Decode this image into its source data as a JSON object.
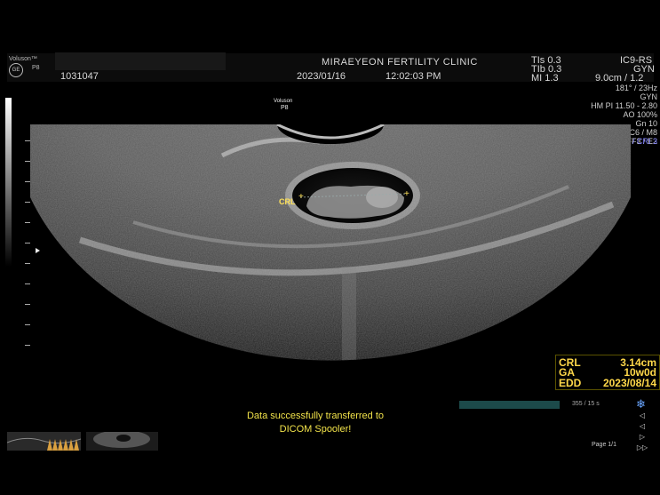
{
  "header": {
    "brand": "Voluson™",
    "probe_small": "P8",
    "patient_id": "1031047",
    "clinic": "MIRAEYEON FERTILITY CLINIC",
    "date": "2023/01/16",
    "time": "12:02:03 PM",
    "tis": "TIs  0.3",
    "tib": "TIb  0.3",
    "mi": "MI   1.3",
    "probe_mode": "IC9-RS",
    "app": "GYN",
    "depth": "9.0cm / 1.2"
  },
  "right_params": [
    "181° / 23Hz",
    "GYN",
    "HM PI 11.50 - 2.80",
    "AO 100%",
    "Gn 10",
    "C6 / M8",
    "FF3 / E2",
    "SRI II 3 / CRI 3"
  ],
  "probe_overlay": {
    "brand": "Voluson",
    "probe": "P8"
  },
  "measurement": {
    "crl_marker": "CRL"
  },
  "results": [
    {
      "label": "CRL",
      "value": "3.14cm"
    },
    {
      "label": "GA",
      "value": "10w0d"
    },
    {
      "label": "EDD",
      "value": "2023/08/14"
    }
  ],
  "status": {
    "line1": "Data successfully transferred to",
    "line2": "DICOM Spooler!"
  },
  "cine": {
    "count": "355 / 15 s",
    "page": "Page 1/1"
  },
  "nav": {
    "up": "◁",
    "left": "◁",
    "right": "▷",
    "end": "▷▷"
  },
  "colors": {
    "measurement": "#ffd84a",
    "status": "#f2e34a",
    "srs": "#7a7aff"
  }
}
